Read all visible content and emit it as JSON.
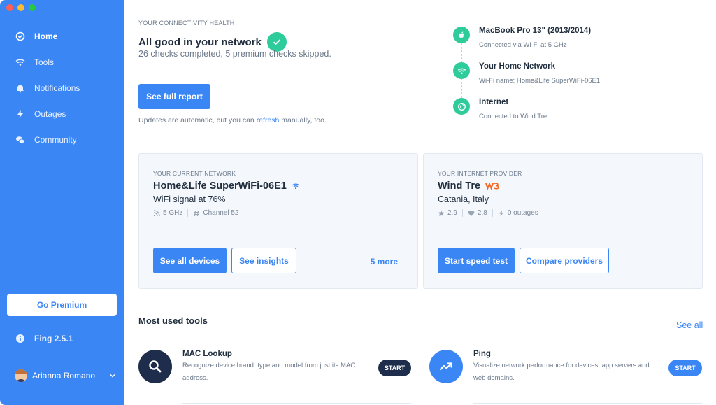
{
  "window": {
    "traffic_colors": [
      "#fe5f57",
      "#febc2e",
      "#28c840"
    ]
  },
  "sidebar": {
    "items": [
      {
        "label": "Home",
        "icon": "check-circle-icon",
        "active": true
      },
      {
        "label": "Tools",
        "icon": "wifi-icon"
      },
      {
        "label": "Notifications",
        "icon": "bell-icon"
      },
      {
        "label": "Outages",
        "icon": "lightning-icon"
      },
      {
        "label": "Community",
        "icon": "chat-icon"
      }
    ],
    "premium_label": "Go Premium",
    "version": "Fing 2.5.1",
    "user_name": "Arianna Romano"
  },
  "health": {
    "eyebrow": "YOUR CONNECTIVITY HEALTH",
    "title": "All good in your network",
    "subtitle": "26 checks completed, 5 premium checks skipped.",
    "report_button": "See full report",
    "updates_prefix": "Updates are automatic, but you can ",
    "updates_link": "refresh",
    "updates_suffix": " manually, too."
  },
  "chain": [
    {
      "title": "MacBook Pro 13\" (2013/2014)",
      "sub": "Connected via Wi-Fi at 5 GHz",
      "icon": "apple-icon"
    },
    {
      "title": "Your Home Network",
      "sub": "Wi-Fi name: Home&Life SuperWiFi-06E1",
      "icon": "wifi-icon"
    },
    {
      "title": "Internet",
      "sub": "Connected to Wind Tre",
      "icon": "globe-icon"
    }
  ],
  "network_card": {
    "eyebrow": "YOUR CURRENT NETWORK",
    "title": "Home&Life SuperWiFi-06E1",
    "signal": "WiFi signal at 76%",
    "band": "5 GHz",
    "channel": "Channel 52",
    "btn_devices": "See all devices",
    "btn_insights": "See insights",
    "more": "5 more"
  },
  "isp_card": {
    "eyebrow": "YOUR INTERNET PROVIDER",
    "title": "Wind Tre",
    "location": "Catania, Italy",
    "rating": "2.9",
    "likes": "2.8",
    "outages": "0 outages",
    "btn_speed": "Start speed test",
    "btn_compare": "Compare providers"
  },
  "tools": {
    "title": "Most used tools",
    "see_all": "See all",
    "items": [
      {
        "title": "MAC Lookup",
        "desc": "Recognize device brand, type and model from just its MAC address.",
        "start": "START",
        "icon": "magnifier-icon"
      },
      {
        "title": "Ping",
        "desc": "Visualize network performance for devices, app servers and web domains.",
        "start": "START",
        "icon": "trend-up-icon"
      }
    ]
  },
  "colors": {
    "accent": "#3a86f4",
    "success": "#2ecc9a",
    "dark_navy": "#1f2d4d"
  }
}
